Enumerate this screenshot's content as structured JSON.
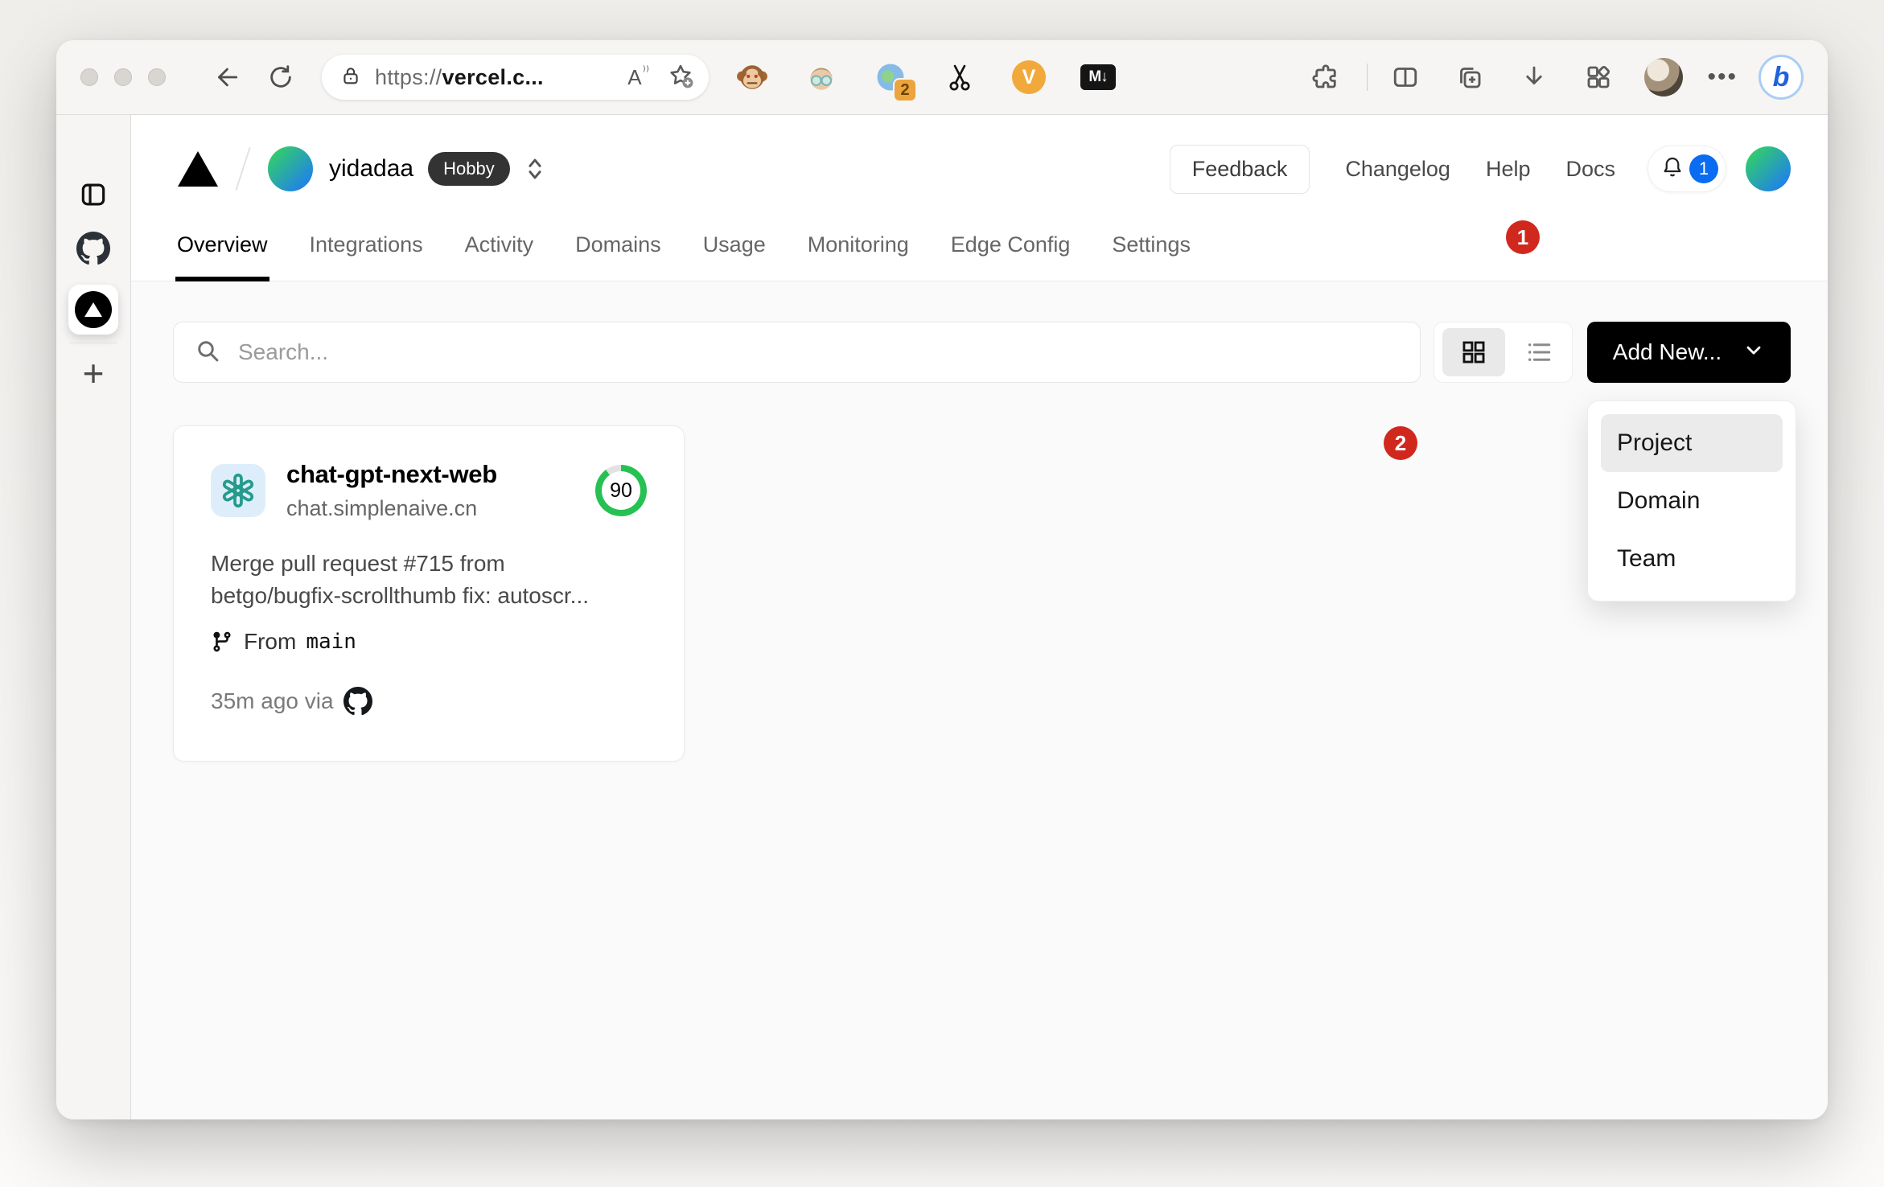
{
  "browser": {
    "url": {
      "scheme": "https://",
      "host": "vercel.c..."
    },
    "read_aloud_label": "A",
    "read_aloud_waves": ")))",
    "extensions": {
      "proxy_badge": "2",
      "markdown_label": "M↓",
      "capture_label": "V"
    },
    "more_label": "•••",
    "bing_label": "b"
  },
  "sidebar": {
    "new_tab_label": "+"
  },
  "vercel": {
    "team": {
      "name": "yidadaa",
      "plan_badge": "Hobby"
    },
    "header_links": {
      "feedback": "Feedback",
      "changelog": "Changelog",
      "help": "Help",
      "docs": "Docs"
    },
    "notifications_count": "1",
    "tabs": [
      {
        "label": "Overview",
        "active": true
      },
      {
        "label": "Integrations",
        "active": false
      },
      {
        "label": "Activity",
        "active": false
      },
      {
        "label": "Domains",
        "active": false
      },
      {
        "label": "Usage",
        "active": false
      },
      {
        "label": "Monitoring",
        "active": false
      },
      {
        "label": "Edge Config",
        "active": false
      },
      {
        "label": "Settings",
        "active": false
      }
    ],
    "search_placeholder": "Search...",
    "add_new_label": "Add New...",
    "dropdown_items": [
      {
        "label": "Project",
        "highlighted": true
      },
      {
        "label": "Domain",
        "highlighted": false
      },
      {
        "label": "Team",
        "highlighted": false
      }
    ],
    "project_card": {
      "name": "chat-gpt-next-web",
      "domain": "chat.simplenaive.cn",
      "score": "90",
      "commit_line1": "Merge pull request #715 from",
      "commit_line2": "betgo/bugfix-scrollthumb fix: autoscr...",
      "branch_label": "From",
      "branch_name": "main",
      "deployed_meta": "35m ago via"
    }
  },
  "annotations": {
    "step1": "1",
    "step2": "2"
  },
  "colors": {
    "annotation_red": "#d1281e",
    "add_new_bg": "#000000",
    "score_green": "#26c153",
    "notification_blue": "#0a6cf1",
    "hobby_badge_bg": "#333333",
    "openai_teal": "#259a8d",
    "openai_tile_bg": "#ddeefa",
    "avatar_gradient": [
      "#33d263",
      "#1f7bf4"
    ]
  },
  "icons": {
    "search_icon": "magnifier",
    "bell_icon": "bell",
    "chevron_down_icon": "chevron-down",
    "grid_view_icon": "grid",
    "list_view_icon": "list",
    "git_branch_icon": "git-branch",
    "github_icon": "octocat",
    "vercel_logo": "triangle"
  }
}
